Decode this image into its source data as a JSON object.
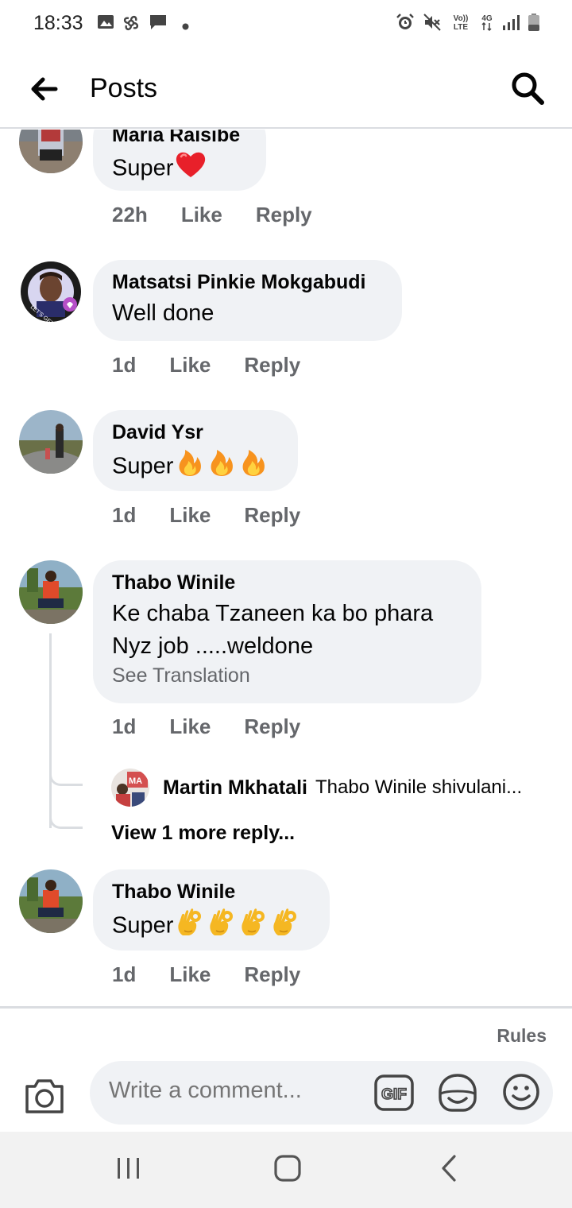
{
  "status_bar": {
    "time": "18:33",
    "left_icons": [
      "gallery-icon",
      "pinwheel-icon",
      "message-icon",
      "dot-icon"
    ],
    "right_icons": [
      "alarm-icon",
      "mute-icon",
      "volte-icon",
      "4g-icon",
      "signal-icon",
      "battery-icon"
    ],
    "volte_label": "Vo)) LTE",
    "network_label": "4G"
  },
  "header": {
    "title": "Posts",
    "back_icon": "arrow-left-icon",
    "search_icon": "search-icon"
  },
  "comments": [
    {
      "author": "Maria Raisibe",
      "text": "Super",
      "emojis": [
        "red-heart"
      ],
      "time": "22h",
      "like": "Like",
      "reply": "Reply"
    },
    {
      "author": "Matsatsi Pinkie Mokgabudi",
      "text": "Well done",
      "emojis": [],
      "time": "1d",
      "like": "Like",
      "reply": "Reply",
      "avatar_badge": "LET'S GET VACCINATED"
    },
    {
      "author": "David Ysr",
      "text": "Super",
      "emojis": [
        "fire",
        "fire",
        "fire"
      ],
      "time": "1d",
      "like": "Like",
      "reply": "Reply"
    },
    {
      "author": "Thabo Winile",
      "text_lines": [
        "Ke chaba Tzaneen  ka bo phara",
        "Nyz job .....weldone"
      ],
      "see_translation": "See Translation",
      "time": "1d",
      "like": "Like",
      "reply": "Reply",
      "replies": [
        {
          "author": "Martin Mkhatali",
          "text": "Thabo Winile shivulani..."
        }
      ],
      "view_more": "View 1 more reply..."
    },
    {
      "author": "Thabo Winile",
      "text": "Super",
      "emojis": [
        "ok-hand",
        "ok-hand",
        "ok-hand",
        "ok-hand"
      ],
      "time": "1d",
      "like": "Like",
      "reply": "Reply"
    }
  ],
  "composer": {
    "rules": "Rules",
    "placeholder": "Write a comment...",
    "gif_label": "GIF",
    "icons": [
      "camera-icon",
      "gif-icon",
      "sticker-icon",
      "smiley-icon"
    ]
  },
  "navbar": {
    "icons": [
      "recent-apps-icon",
      "home-icon",
      "back-icon"
    ]
  },
  "colors": {
    "bubble": "#f0f2f5",
    "secondary_text": "#65676b",
    "divider": "#dadde1",
    "heart": "#e8202a",
    "fire": "#f7931e",
    "ok_hand": "#f5b722"
  }
}
